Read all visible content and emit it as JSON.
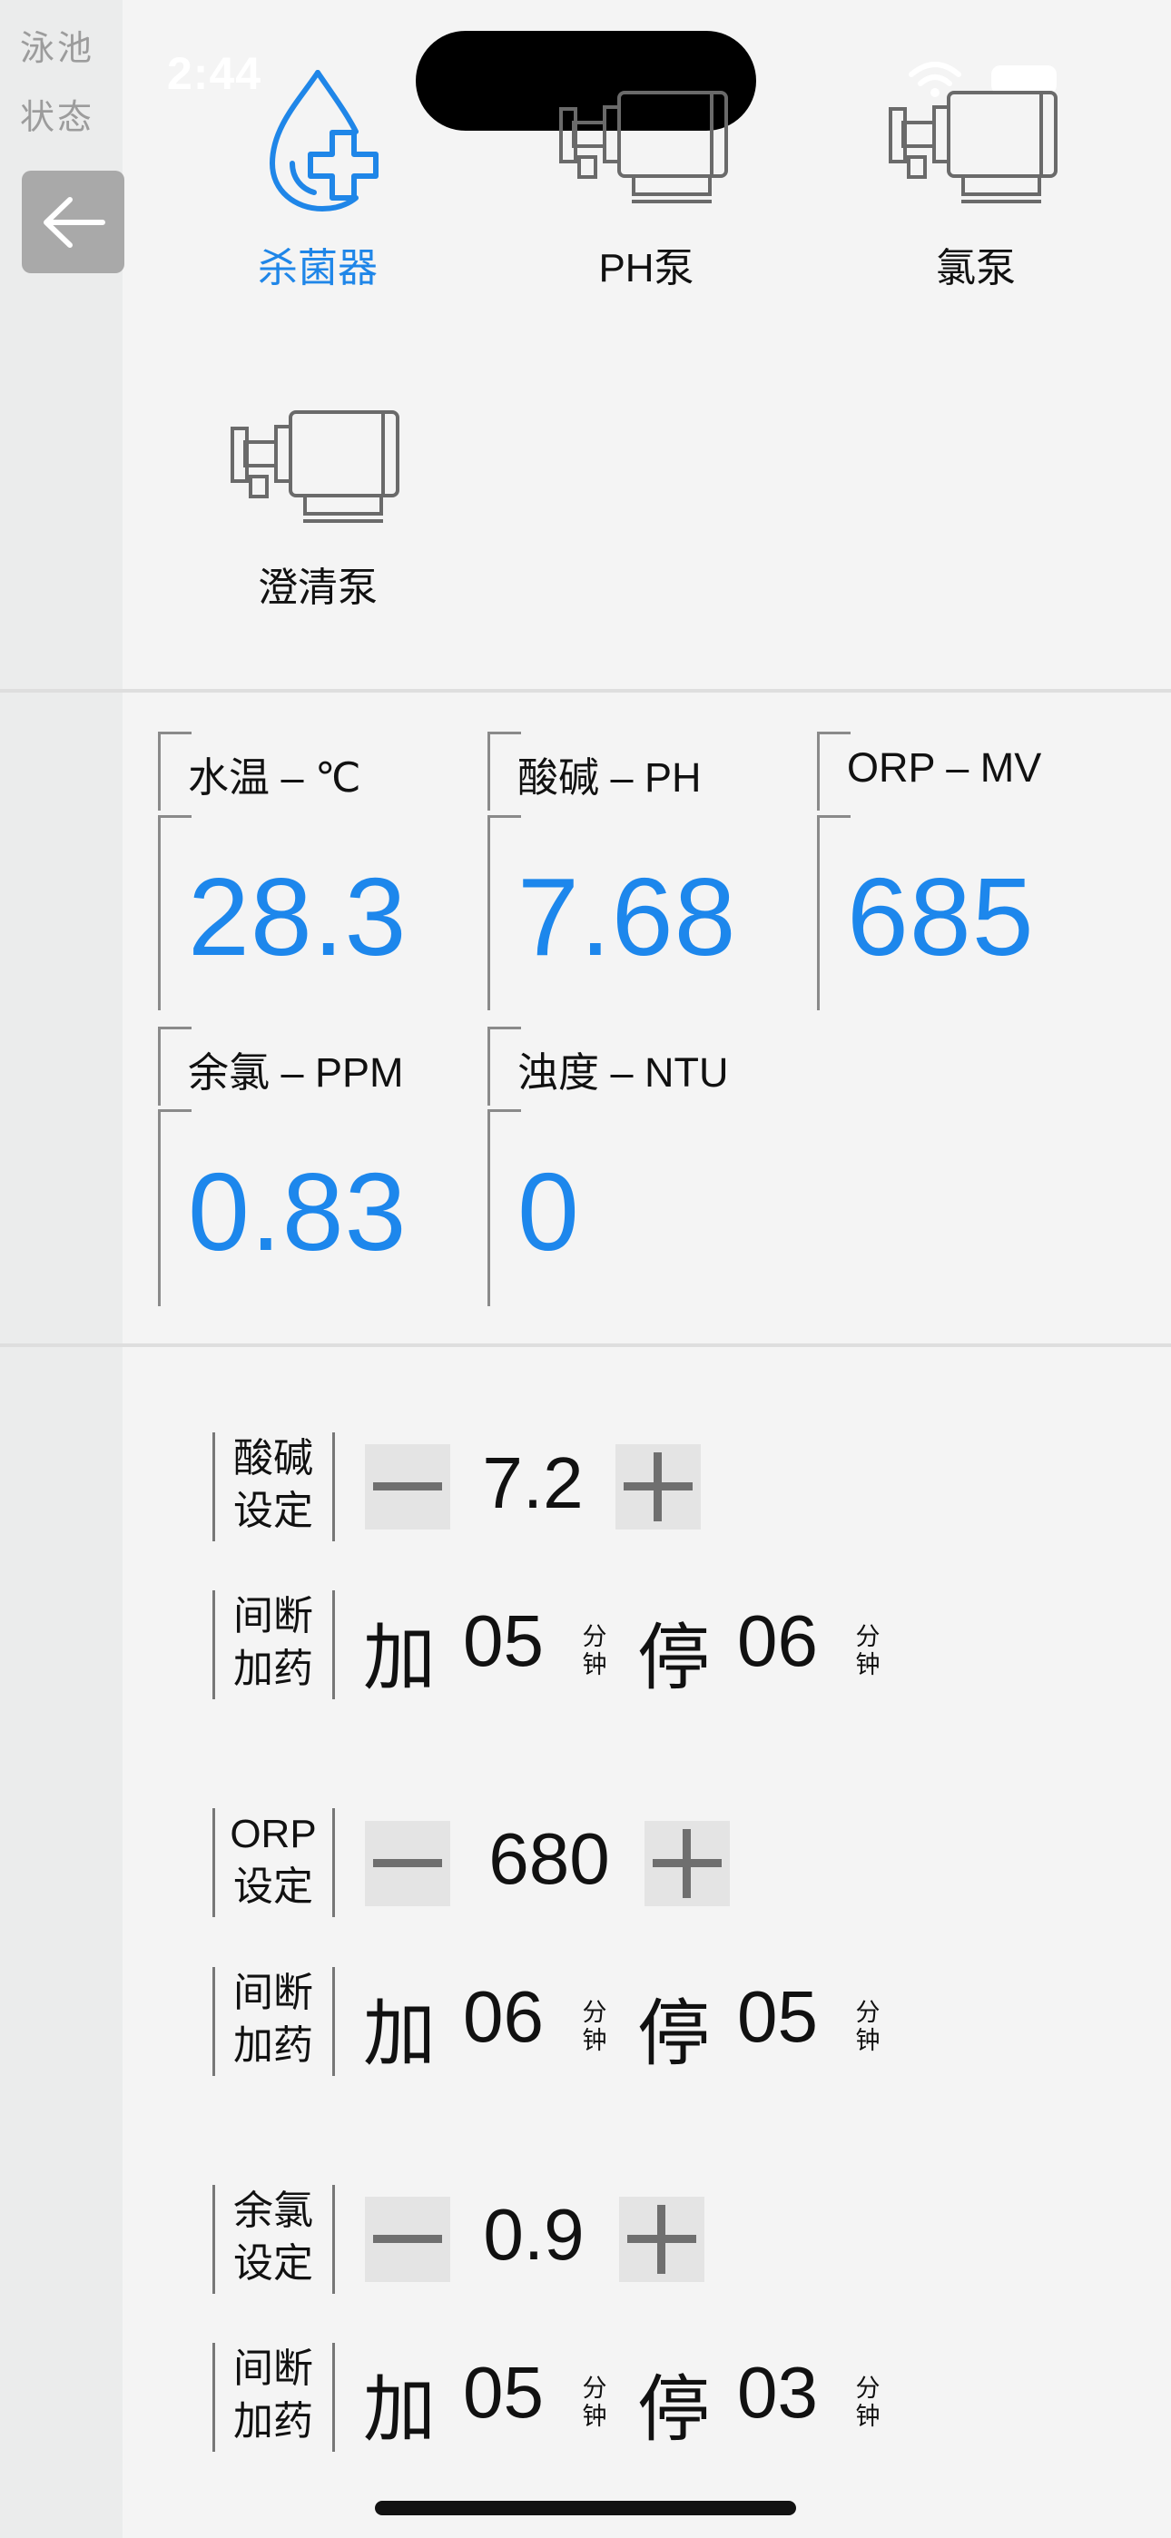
{
  "status_bar": {
    "time": "2:44"
  },
  "sidebar": {
    "line1": "泳池",
    "line2": "状态"
  },
  "devices": [
    {
      "label": "杀菌器",
      "icon": "sterilizer-drop-plus-icon",
      "active": true
    },
    {
      "label": "PH泵",
      "icon": "pump-icon",
      "active": false
    },
    {
      "label": "氯泵",
      "icon": "pump-icon",
      "active": false
    },
    {
      "label": "澄清泵",
      "icon": "pump-icon",
      "active": false
    }
  ],
  "readings": [
    {
      "title": "水温 – ℃",
      "value": "28.3"
    },
    {
      "title": "酸碱 – PH",
      "value": "7.68"
    },
    {
      "title": "ORP – MV",
      "value": "685"
    },
    {
      "title": "余氯 – PPM",
      "value": "0.83"
    },
    {
      "title": "浊度 – NTU",
      "value": "0"
    }
  ],
  "settings": [
    {
      "label1": "酸碱",
      "label2": "设定",
      "value": "7.2",
      "interval": {
        "label1": "间断",
        "label2": "加药",
        "add": "加",
        "add_value": "05",
        "stop": "停",
        "stop_value": "06",
        "unit1": "分",
        "unit2": "钟"
      }
    },
    {
      "label1": "ORP",
      "label2": "设定",
      "value": "680",
      "interval": {
        "label1": "间断",
        "label2": "加药",
        "add": "加",
        "add_value": "06",
        "stop": "停",
        "stop_value": "05",
        "unit1": "分",
        "unit2": "钟"
      }
    },
    {
      "label1": "余氯",
      "label2": "设定",
      "value": "0.9",
      "interval": {
        "label1": "间断",
        "label2": "加药",
        "add": "加",
        "add_value": "05",
        "stop": "停",
        "stop_value": "03",
        "unit1": "分",
        "unit2": "钟"
      }
    }
  ],
  "colors": {
    "accent": "#1d87ec",
    "rail": "#ebecec",
    "button": "#e4e4e4"
  }
}
